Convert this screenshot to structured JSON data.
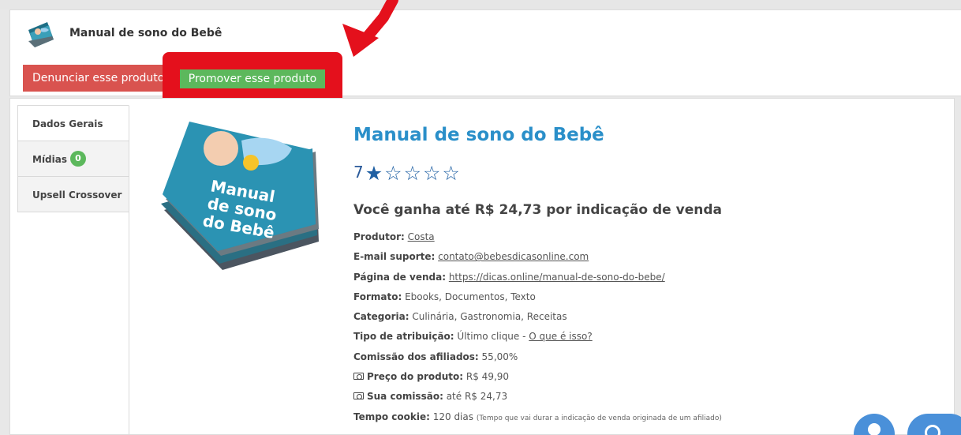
{
  "header": {
    "title": "Manual de sono do Bebê",
    "report_label": "Denunciar esse produto",
    "promote_label": "Promover esse produto"
  },
  "tabs": [
    {
      "label": "Dados Gerais"
    },
    {
      "label": "Mídias",
      "badge": "0"
    },
    {
      "label": "Upsell Crossover"
    }
  ],
  "product": {
    "title": "Manual de sono do Bebê",
    "rating": "7",
    "stars_filled": 1,
    "stars_total": 5,
    "earn_text": "Você ganha até R$ 24,73 por indicação de venda",
    "cover_text": [
      "Manual",
      "de sono",
      "do Bebê"
    ]
  },
  "info": {
    "producer_label": "Produtor:",
    "producer_value": "Costa",
    "email_label": "E-mail suporte:",
    "email_value": "contato@bebesdicasonline.com",
    "sales_label": "Página de venda:",
    "sales_value": "https://dicas.online/manual-de-sono-do-bebe/",
    "format_label": "Formato:",
    "format_value": "Ebooks, Documentos, Texto",
    "category_label": "Categoria:",
    "category_value": "Culinária, Gastronomia, Receitas",
    "attribution_label": "Tipo de atribuição:",
    "attribution_value": "Último clique -",
    "attribution_link": "O que é isso?",
    "commission_label": "Comissão dos afiliados:",
    "commission_value": "55,00%",
    "price_label": "Preço do produto:",
    "price_value": "R$ 49,90",
    "your_commission_label": "Sua comissão:",
    "your_commission_value": "até R$ 24,73",
    "cookie_label": "Tempo cookie:",
    "cookie_value": "120 dias",
    "cookie_note": "(Tempo que vai durar a indicação de venda originada de um afiliado)"
  },
  "colors": {
    "title_blue": "#2a8fc9",
    "star_blue": "#1e5fa3",
    "danger": "#d9534f",
    "success": "#5cb85c",
    "highlight_red": "#e4101c",
    "chat_blue": "#4a90d9"
  },
  "icons": {
    "money": "money-icon",
    "star_filled": "star-filled-icon",
    "star_empty": "star-outline-icon"
  }
}
